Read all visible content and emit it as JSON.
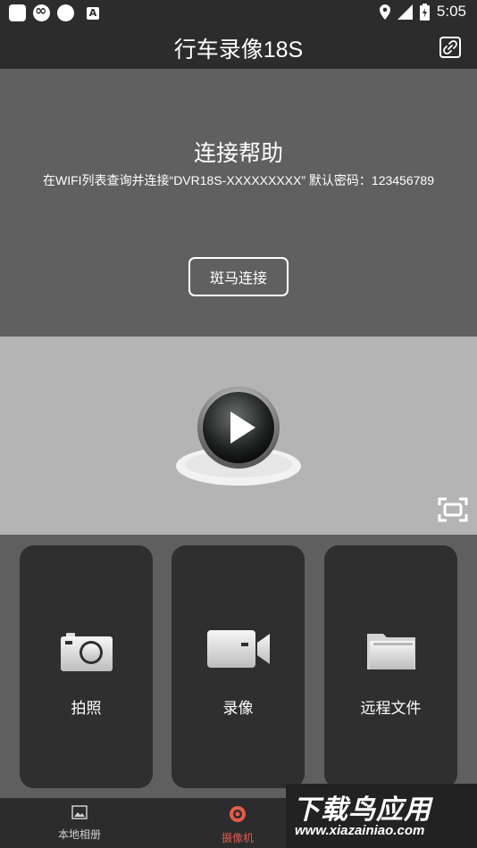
{
  "status_bar": {
    "time": "5:05"
  },
  "header": {
    "title": "行车录像18S"
  },
  "help": {
    "title": "连接帮助",
    "description": "在WIFI列表查询并连接“DVR18S-XXXXXXXXX” 默认密码：123456789",
    "connect_button": "斑马连接"
  },
  "actions": [
    {
      "label": "拍照"
    },
    {
      "label": "录像"
    },
    {
      "label": "远程文件"
    }
  ],
  "bottom_nav": [
    {
      "label": "本地相册"
    },
    {
      "label": "摄像机"
    }
  ],
  "watermark": {
    "title": "下载鸟应用",
    "url": "www.xiazainiao.com"
  },
  "colors": {
    "active": "#e45a4b",
    "header": "#2c2c2c",
    "card": "#2f2f2f"
  }
}
